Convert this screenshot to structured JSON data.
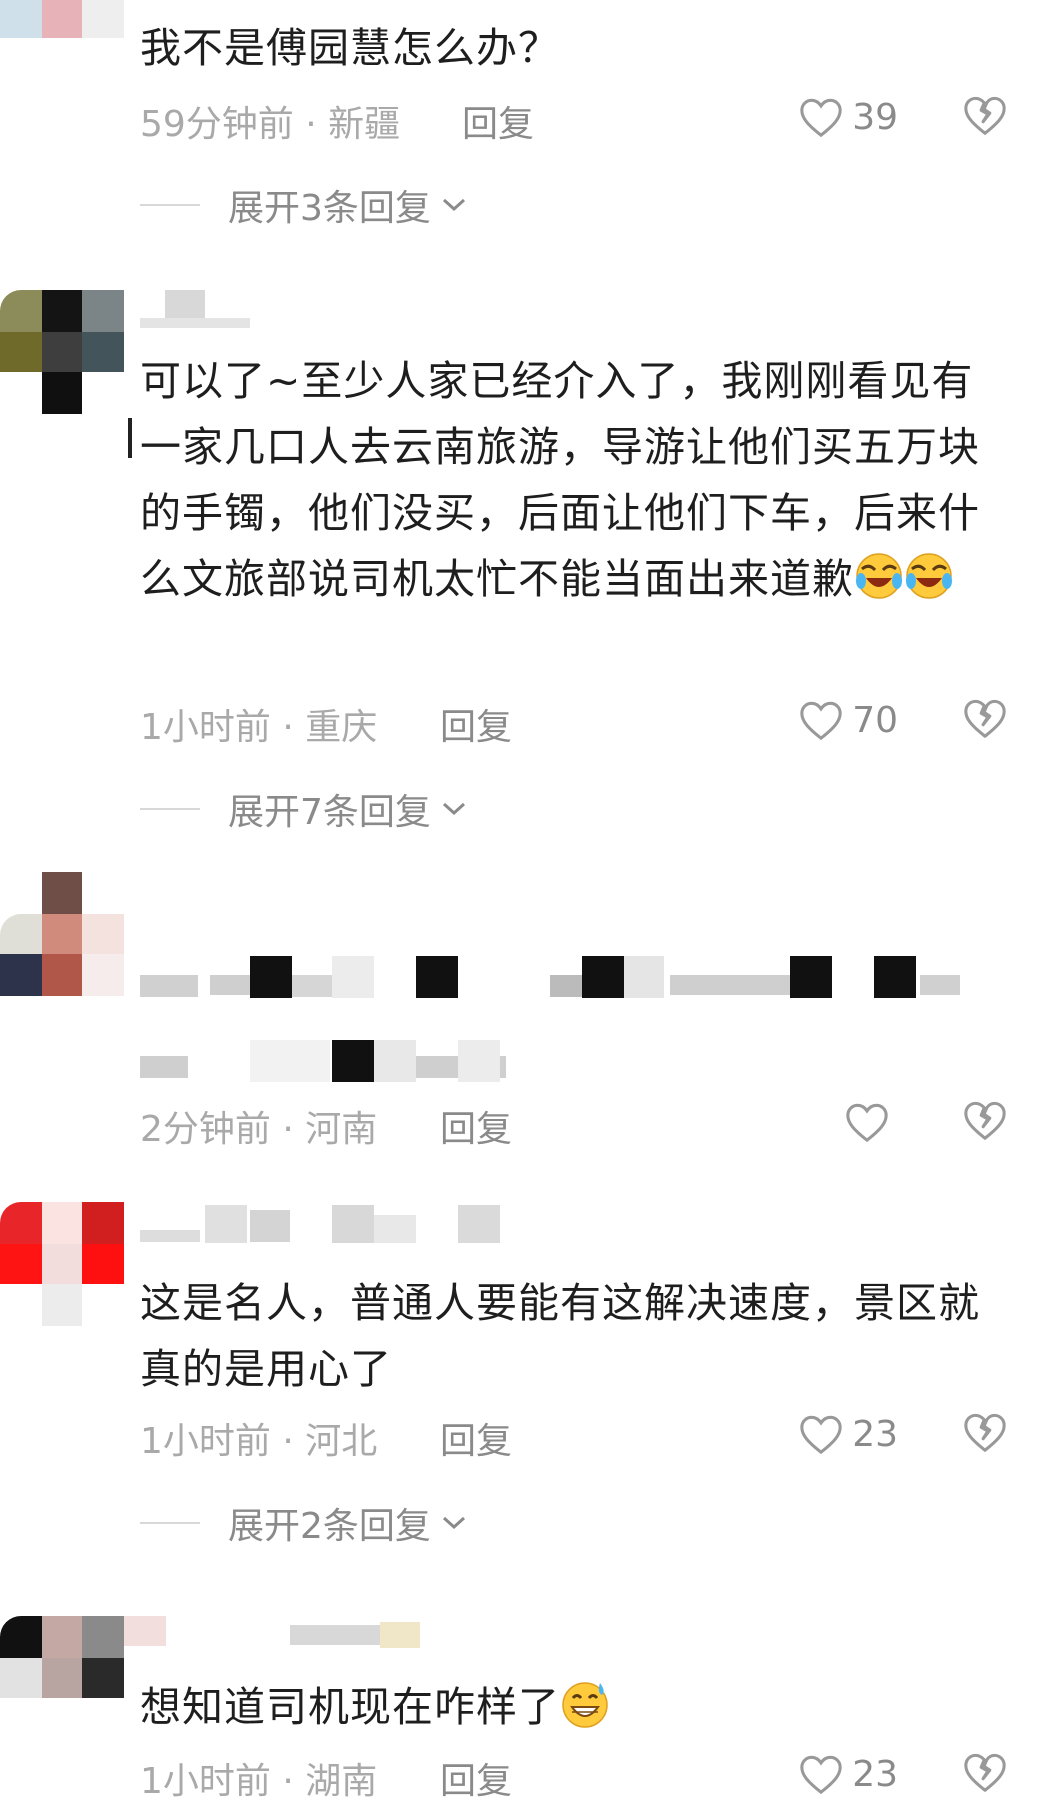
{
  "comments": [
    {
      "body": "我不是傅园慧怎么办？",
      "time_location": "59分钟前 · 新疆",
      "reply_label": "回复",
      "likes": "39",
      "expand_label": "展开3条回复"
    },
    {
      "body": "可以了~至少人家已经介入了，我刚刚看见有一家几口人去云南旅游，导游让他们买五万块的手镯，他们没买，后面让他们下车，后来什么文旅部说司机太忙不能当面出来道歉",
      "time_location": "1小时前 · 重庆",
      "reply_label": "回复",
      "likes": "70",
      "expand_label": "展开7条回复"
    },
    {
      "body": "",
      "time_location": "2分钟前 · 河南",
      "reply_label": "回复",
      "likes": ""
    },
    {
      "body": "这是名人，普通人要能有这解决速度，景区就真的是用心了",
      "time_location": "1小时前 · 河北",
      "reply_label": "回复",
      "likes": "23",
      "expand_label": "展开2条回复"
    },
    {
      "body": "想知道司机现在咋样了",
      "time_location": "1小时前 · 湖南",
      "reply_label": "回复",
      "likes": "23"
    }
  ],
  "icons": {
    "like": "heart-outline-icon",
    "dislike": "broken-heart-icon",
    "expand": "chevron-down-icon",
    "emoji_laugh": "rolling-laughing-emoji",
    "emoji_sweat": "grinning-sweat-emoji"
  },
  "colors": {
    "meta_text": "#a9a9a9",
    "action_text": "#8a8a8a",
    "body_text": "#1e1e1e"
  }
}
